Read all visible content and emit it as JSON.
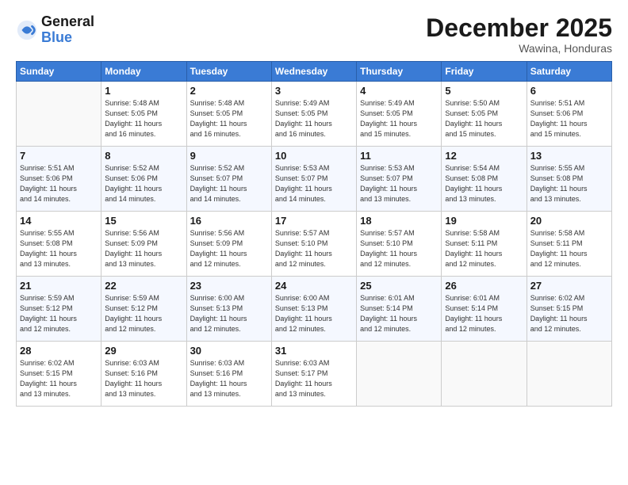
{
  "header": {
    "logo_line1": "General",
    "logo_line2": "Blue",
    "month": "December 2025",
    "location": "Wawina, Honduras"
  },
  "weekdays": [
    "Sunday",
    "Monday",
    "Tuesday",
    "Wednesday",
    "Thursday",
    "Friday",
    "Saturday"
  ],
  "weeks": [
    [
      {
        "day": "",
        "info": ""
      },
      {
        "day": "1",
        "info": "Sunrise: 5:48 AM\nSunset: 5:05 PM\nDaylight: 11 hours\nand 16 minutes."
      },
      {
        "day": "2",
        "info": "Sunrise: 5:48 AM\nSunset: 5:05 PM\nDaylight: 11 hours\nand 16 minutes."
      },
      {
        "day": "3",
        "info": "Sunrise: 5:49 AM\nSunset: 5:05 PM\nDaylight: 11 hours\nand 16 minutes."
      },
      {
        "day": "4",
        "info": "Sunrise: 5:49 AM\nSunset: 5:05 PM\nDaylight: 11 hours\nand 15 minutes."
      },
      {
        "day": "5",
        "info": "Sunrise: 5:50 AM\nSunset: 5:05 PM\nDaylight: 11 hours\nand 15 minutes."
      },
      {
        "day": "6",
        "info": "Sunrise: 5:51 AM\nSunset: 5:06 PM\nDaylight: 11 hours\nand 15 minutes."
      }
    ],
    [
      {
        "day": "7",
        "info": "Sunrise: 5:51 AM\nSunset: 5:06 PM\nDaylight: 11 hours\nand 14 minutes."
      },
      {
        "day": "8",
        "info": "Sunrise: 5:52 AM\nSunset: 5:06 PM\nDaylight: 11 hours\nand 14 minutes."
      },
      {
        "day": "9",
        "info": "Sunrise: 5:52 AM\nSunset: 5:07 PM\nDaylight: 11 hours\nand 14 minutes."
      },
      {
        "day": "10",
        "info": "Sunrise: 5:53 AM\nSunset: 5:07 PM\nDaylight: 11 hours\nand 14 minutes."
      },
      {
        "day": "11",
        "info": "Sunrise: 5:53 AM\nSunset: 5:07 PM\nDaylight: 11 hours\nand 13 minutes."
      },
      {
        "day": "12",
        "info": "Sunrise: 5:54 AM\nSunset: 5:08 PM\nDaylight: 11 hours\nand 13 minutes."
      },
      {
        "day": "13",
        "info": "Sunrise: 5:55 AM\nSunset: 5:08 PM\nDaylight: 11 hours\nand 13 minutes."
      }
    ],
    [
      {
        "day": "14",
        "info": "Sunrise: 5:55 AM\nSunset: 5:08 PM\nDaylight: 11 hours\nand 13 minutes."
      },
      {
        "day": "15",
        "info": "Sunrise: 5:56 AM\nSunset: 5:09 PM\nDaylight: 11 hours\nand 13 minutes."
      },
      {
        "day": "16",
        "info": "Sunrise: 5:56 AM\nSunset: 5:09 PM\nDaylight: 11 hours\nand 12 minutes."
      },
      {
        "day": "17",
        "info": "Sunrise: 5:57 AM\nSunset: 5:10 PM\nDaylight: 11 hours\nand 12 minutes."
      },
      {
        "day": "18",
        "info": "Sunrise: 5:57 AM\nSunset: 5:10 PM\nDaylight: 11 hours\nand 12 minutes."
      },
      {
        "day": "19",
        "info": "Sunrise: 5:58 AM\nSunset: 5:11 PM\nDaylight: 11 hours\nand 12 minutes."
      },
      {
        "day": "20",
        "info": "Sunrise: 5:58 AM\nSunset: 5:11 PM\nDaylight: 11 hours\nand 12 minutes."
      }
    ],
    [
      {
        "day": "21",
        "info": "Sunrise: 5:59 AM\nSunset: 5:12 PM\nDaylight: 11 hours\nand 12 minutes."
      },
      {
        "day": "22",
        "info": "Sunrise: 5:59 AM\nSunset: 5:12 PM\nDaylight: 11 hours\nand 12 minutes."
      },
      {
        "day": "23",
        "info": "Sunrise: 6:00 AM\nSunset: 5:13 PM\nDaylight: 11 hours\nand 12 minutes."
      },
      {
        "day": "24",
        "info": "Sunrise: 6:00 AM\nSunset: 5:13 PM\nDaylight: 11 hours\nand 12 minutes."
      },
      {
        "day": "25",
        "info": "Sunrise: 6:01 AM\nSunset: 5:14 PM\nDaylight: 11 hours\nand 12 minutes."
      },
      {
        "day": "26",
        "info": "Sunrise: 6:01 AM\nSunset: 5:14 PM\nDaylight: 11 hours\nand 12 minutes."
      },
      {
        "day": "27",
        "info": "Sunrise: 6:02 AM\nSunset: 5:15 PM\nDaylight: 11 hours\nand 12 minutes."
      }
    ],
    [
      {
        "day": "28",
        "info": "Sunrise: 6:02 AM\nSunset: 5:15 PM\nDaylight: 11 hours\nand 13 minutes."
      },
      {
        "day": "29",
        "info": "Sunrise: 6:03 AM\nSunset: 5:16 PM\nDaylight: 11 hours\nand 13 minutes."
      },
      {
        "day": "30",
        "info": "Sunrise: 6:03 AM\nSunset: 5:16 PM\nDaylight: 11 hours\nand 13 minutes."
      },
      {
        "day": "31",
        "info": "Sunrise: 6:03 AM\nSunset: 5:17 PM\nDaylight: 11 hours\nand 13 minutes."
      },
      {
        "day": "",
        "info": ""
      },
      {
        "day": "",
        "info": ""
      },
      {
        "day": "",
        "info": ""
      }
    ]
  ]
}
